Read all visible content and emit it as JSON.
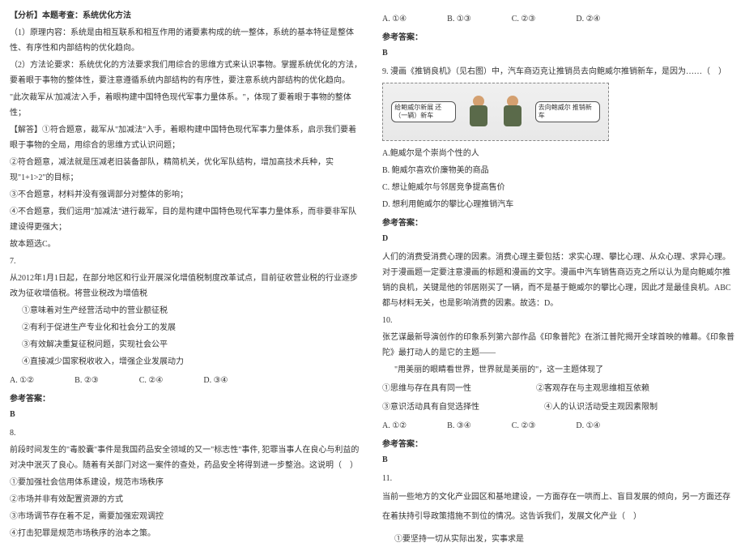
{
  "left": {
    "analysis_label": "【分析】本题考查：系统优化方法",
    "p1": "（1）原理内容：系统是由相互联系和相互作用的诸要素构成的统一整体，系统的基本特征是整体性、有序性和内部结构的优化趋向。",
    "p2": "（2）方法论要求：系统优化的方法要求我们用综合的思维方式来认识事物。掌握系统优化的方法，要着眼于事物的整体性，要注意遵循系统内部结构的有序性，要注意系统内部结构的优化趋向。",
    "p3": "\"此次裁军从'加减法'入手，着眼构建中国特色现代军事力量体系。\"，体现了要着眼于事物的整体性；",
    "solve_label": "【解答】①符合题意，裁军从\"加减法\"入手，着眼构建中国特色现代军事力量体系，启示我们要着眼于事物的全局，用综合的思维方式认识问题；",
    "p4": "②符合题意，减法就是压减老旧装备部队，精简机关，优化军队结构，增加高技术兵种，实现\"1+1>2\"的目标；",
    "p5": "③不合题意，材料并没有强调部分对整体的影响；",
    "p6": "④不合题意，我们运用\"加减法\"进行裁军，目的是构建中国特色现代军事力量体系，而非要非军队建设得更强大；",
    "p7": "故本题选C。",
    "q7": "7.",
    "q7_text": "从2012年1月1日起，在部分地区和行业开展深化增值税制度改革试点，目前征收营业税的行业逐步改为征收增值税。将营业税改为增值税",
    "q7_1": "①意味着对生产经营活动中的营业额征税",
    "q7_2": "②有利于促进生产专业化和社会分工的发展",
    "q7_3": "③有效解决重复征税问题，实现社会公平",
    "q7_4": "④直接减少国家税收收入，增强企业发展动力",
    "q7_opts": {
      "a": "A. ①②",
      "b": "B. ②③",
      "c": "C. ②④",
      "d": "D. ③④"
    },
    "ans_label": "参考答案：",
    "q7_ans": "B",
    "q8": "8.",
    "q8_text": "前段时间发生的\"毒胶囊\"事件是我国药品安全领域的又一\"标志性\"事件, 犯罪当事人在良心与利益的对决中泯灭了良心。随着有关部门对这一案件的查处，药品安全将得到进一步整治。这说明（　）",
    "q8_1": "①要加强社会信用体系建设，规范市场秩序",
    "q8_2": "②市场并非有效配置资源的方式",
    "q8_3": "③市场调节存在着不足，需要加强宏观调控",
    "q8_4": "④打击犯罪是规范市场秩序的治本之策。"
  },
  "right": {
    "q8_opts": {
      "a": "A. ①④",
      "b": "B. ①③",
      "c": "C. ②③",
      "d": "D. ②④"
    },
    "ans_label": "参考答案：",
    "q8_ans": "B",
    "q9": "9.",
    "q9_text": "漫画《推销良机》（见右图）中，汽车商迈克让推销员去向鲍威尔推销新车，是因为……（　）",
    "bubble_left": "给鲍威尔新展\n还（一辆）新车",
    "bubble_right": "去向鲍威尔\n推销新车",
    "q9_a": "A.鲍威尔是个崇尚个性的人",
    "q9_b": "B. 鲍威尔喜欢价廉物美的商品",
    "q9_c": "C. 想让鲍威尔与邻居竞争提高售价",
    "q9_d": "D. 想利用鲍威尔的攀比心理推销汽车",
    "q9_ans": "D",
    "q9_explain": "人们的消费受消费心理的因素。消费心理主要包括：求实心理、攀比心理、从众心理、求异心理。对于漫画题一定要注意漫画的标题和漫画的文字。漫画中汽车销售商迈克之所以认为是向鲍威尔推销的良机，关键是他的邻居刚买了一辆，而不是基于鲍威尔的攀比心理，因此才是最佳良机。ABC都与材料无关，也是影响消费的因素。故选：D。",
    "q10": "10.",
    "q10_text": "张艺谋最新导演创作的印象系列第六部作品《印象普陀》在浙江普陀揭开全球首映的帷幕。《印象普陀》最打动人的是它的主题——",
    "q10_line": "\"用美丽的眼睛看世界，世界就是美丽的\"，这一主题体现了",
    "q10_1": "①思维与存在具有同一性",
    "q10_2": "②客观存在与主观思维相互依赖",
    "q10_3": "③意识活动具有自觉选择性",
    "q10_4": "④人的认识活动受主观因素限制",
    "q10_opts": {
      "a": "A. ①②",
      "b": "B. ③④",
      "c": "C. ②③",
      "d": "D. ①④"
    },
    "q10_ans": "B",
    "q11": "11.",
    "q11_text": "当前一些地方的文化产业园区和基地建设，一方面存在一哄而上、盲目发展的倾向，另一方面还存在着扶持引导政策措施不到位的情况。这告诉我们，发展文化产业（　）",
    "q11_1": "①要坚持一切从实际出发，实事求是"
  }
}
